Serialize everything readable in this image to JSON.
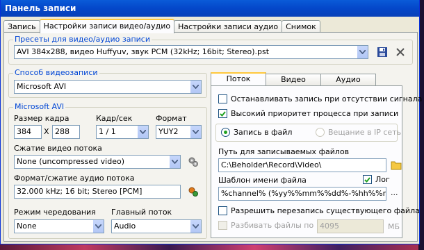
{
  "window": {
    "title": "Панель записи"
  },
  "tabs": [
    "Запись",
    "Настройки записи видео/аудио",
    "Настройки записи аудио",
    "Снимок"
  ],
  "presets": {
    "label": "Пресеты для видео/аудио записи",
    "value": "AVI 384x288, видео Huffyuv, звук PCM (32kHz; 16bit; Stereo).pst"
  },
  "capture_method": {
    "label": "Способ видеозаписи",
    "value": "Microsoft AVI"
  },
  "msavi": {
    "label": "Microsoft AVI",
    "frame_size_label": "Размер кадра",
    "width": "384",
    "x": "X",
    "height": "288",
    "fps_label": "Кадр/сек",
    "fps": "1 / 1",
    "format_label": "Формат",
    "format": "YUY2",
    "video_compression_label": "Сжатие видео потока",
    "video_compression": "None (uncompressed video)",
    "audio_format_label": "Формат/сжатие аудио потока",
    "audio_format": "32.000 kHz; 16 bit; Stereo [PCM]",
    "interleave_label": "Режим чередования",
    "interleave": "None",
    "master_stream_label": "Главный поток",
    "master_stream": "Audio"
  },
  "subtabs": [
    "Поток",
    "Видео",
    "Аудио"
  ],
  "stream": {
    "stop_no_signal": "Останавливать запись при отсутствии сигнала",
    "high_priority": "Высокий приоритет процесса при записи",
    "record_to_file": "Запись в файл",
    "broadcast_ip": "Вещание в IP сеть",
    "path_label": "Путь для записываемых файлов",
    "path": "C:\\Beholder\\Record\\Video\\",
    "template_label": "Шаблон имени файла",
    "log_label": "Лог",
    "template": "%channel% (%yy%%mm%%dd%-%hh%%nn%",
    "more": "...",
    "allow_overwrite": "Разрешить перезапись существующего файла",
    "split_files": "Разбивать файлы по",
    "split_size": "4095",
    "split_unit": "МБ"
  },
  "colors": {
    "title_bar": "#0a5bd8",
    "group_label": "#0046d5",
    "tab_highlight": "#ffc83c"
  }
}
